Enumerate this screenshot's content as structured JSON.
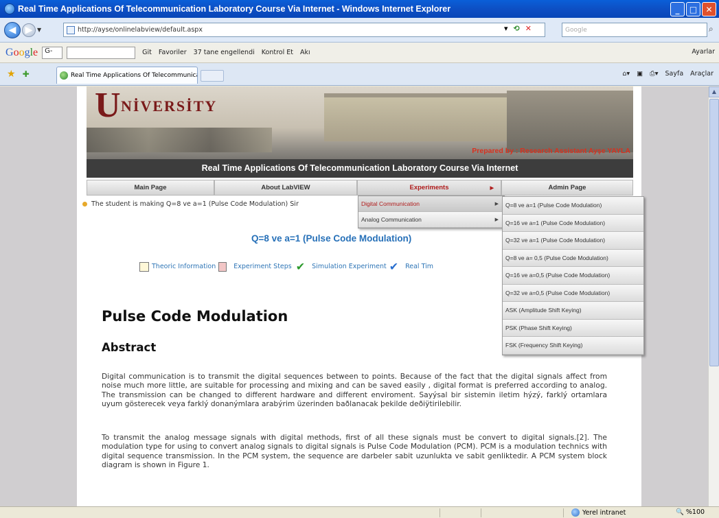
{
  "window": {
    "title": "Real Time Applications Of Telecommunication Laboratory Course Via Internet - Windows Internet Explorer"
  },
  "address": {
    "url": "http://ayse/onlinelabview/default.aspx",
    "search_placeholder": "Google"
  },
  "google_toolbar": {
    "logo": "Google",
    "input": "G-",
    "items": [
      "Git",
      "Favoriler",
      "37 tane engellendi",
      "Kontrol Et",
      "Akı"
    ],
    "right": "Ayarlar"
  },
  "tabs": {
    "active_title": "Real Time Applications Of Telecommunication Laborat..."
  },
  "command_bar": {
    "page": "Sayfa",
    "tools": "Araçlar"
  },
  "site": {
    "banner_logo_letter": "U",
    "banner_logo_text": "NİVERSİTY",
    "prepared_by": "Prepared by : Research Assistant Ayşe YAYLA",
    "course_title": "Real Time Applications Of Telecommunication Laboratory Course Via Internet",
    "menu": [
      "Main Page",
      "About LabVIEW",
      "Experiments",
      "Admin Page"
    ],
    "marquee": "The student is making Q=8 ve a=1 (Pulse Code Modulation) Sir",
    "experiment_title": "Q=8 ve a=1 (Pulse Code Modulation)",
    "links": [
      "Theoric Information",
      "Experiment Steps",
      "Simulation Experiment",
      "Real Tim"
    ],
    "heading": "Pulse Code Modulation",
    "subheading": "Abstract",
    "paragraph1": "Digital communication is to transmit the digital sequences between to points. Because of the fact that the digital signals affect from noise much more little, are suitable for processing and mixing and can be saved easily , digital format is preferred according to analog. The transmission can be changed to different hardware and different enviroment. Sayýsal bir sistemin iletim hýzý, farklý ortamlara uyum gösterecek veya farklý donanýmlara arabýrim üzerinden baðlanacak þekilde deðiÿtirilebilir.",
    "paragraph2": "To transmit the analog message signals with digital methods, first of all these signals must be convert to digital signals.[2]. The modulation type for using to convert analog signals to digital signals is Pulse Code Modulation (PCM). PCM is a modulation technics with digital sequence transmission. In the PCM system, the sequence are darbeler sabit uzunlukta ve sabit genliktedir. A PCM system block diagram is shown in Figure 1."
  },
  "experiments_menu": [
    "Digital Communication",
    "Analog Communication"
  ],
  "digital_submenu": [
    "Q=8 ve a=1  (Pulse Code Modulation)",
    "Q=16 ve a=1 (Pulse Code Modulation)",
    "Q=32 ve a=1 (Pulse Code Modulation)",
    "Q=8 ve a= 0,5 (Pulse Code Modulation)",
    "Q=16 ve a=0,5 (Pulse Code Modulation)",
    "Q=32 ve a=0,5 (Pulse Code Modulation)",
    "ASK (Amplitude Shift Keying)",
    "PSK (Phase Shift Keying)",
    "FSK (Frequency Shift Keying)"
  ],
  "statusbar": {
    "zone": "Yerel intranet",
    "zoom": "%100"
  }
}
